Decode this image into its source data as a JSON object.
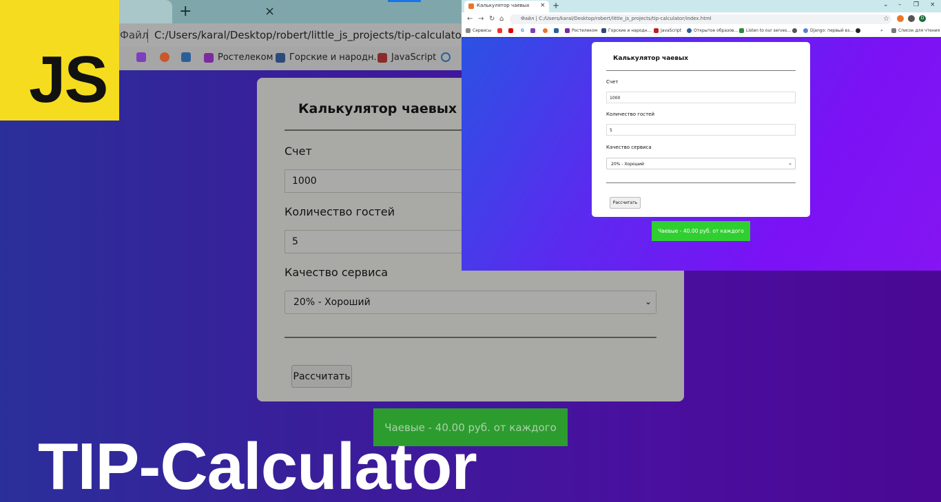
{
  "background_browser": {
    "address_prefix": "Файл",
    "url": "C:/Users/karal/Desktop/robert/little_js_projects/tip-calculator/index.html",
    "bookmarks": [
      "Ростелеком",
      "Горские и народн...",
      "JavaScript"
    ],
    "card": {
      "title": "Калькулятор чаевых",
      "bill_label": "Счет",
      "bill_value": "1000",
      "guests_label": "Количество гостей",
      "guests_value": "5",
      "service_label": "Качество сервиса",
      "service_selected": "20% - Хороший",
      "calculate_label": "Рассчитать"
    },
    "result": "Чаевые - 40.00 руб. от каждого"
  },
  "logo": {
    "text": "JS",
    "color": "#f5dc1f"
  },
  "headline": "TIP-Calculator",
  "foreground_browser": {
    "tab_title": "Калькулятор чаевых",
    "address_prefix": "Файл",
    "url": "C:/Users/karal/Desktop/robert/little_js_projects/tip-calculator/index.html",
    "bookmarks": [
      "Сервисы",
      "Ростелеком",
      "Горские и народн...",
      "JavaScript",
      "Открытое образов...",
      "Listen to our serves...",
      "Django: первый вз..."
    ],
    "reading_list": "Список для чтения",
    "profile_initial": "D",
    "card": {
      "title": "Калькулятор чаевых",
      "bill_label": "Счет",
      "bill_value": "1000",
      "guests_label": "Количество гостей",
      "guests_value": "5",
      "service_label": "Качество сервиса",
      "service_selected": "20% - Хороший",
      "calculate_label": "Рассчитать"
    },
    "result": "Чаевые - 40.00 руб. от каждого",
    "result_color": "#2fcf30"
  },
  "icons": {
    "close": "×",
    "new_tab": "+",
    "chevron_down": "⌄",
    "back": "←",
    "forward": "→",
    "reload": "↻",
    "home": "⌂",
    "star": "☆",
    "minimize": "–",
    "restore": "❐",
    "more_bookmarks": "»"
  }
}
